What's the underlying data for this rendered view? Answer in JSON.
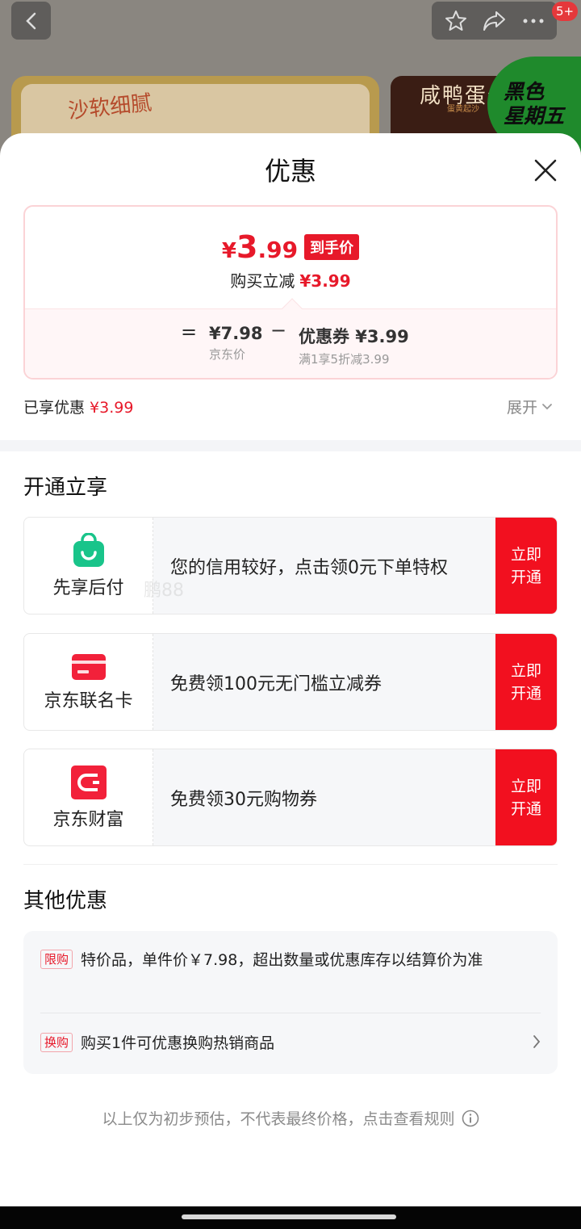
{
  "background": {
    "card1_text": "沙软细腻",
    "card2_title": "咸鸭蛋仁",
    "card2_sub": "蛋黄起沙",
    "promo_badge_line1": "黑色",
    "promo_badge_line2": "星期五",
    "notification_badge": "5+"
  },
  "sheet": {
    "title": "优惠",
    "price": {
      "currency": "¥",
      "integer": "3",
      "decimal": ".99",
      "tag": "到手价",
      "reduce_label": "购买立减",
      "reduce_value": "¥3.99",
      "base_value": "¥7.98",
      "base_label": "京东价",
      "coupon_value": "优惠券 ¥3.99",
      "coupon_label": "满1享5折减3.99",
      "eq": "=",
      "minus": "−"
    },
    "enjoyed_label": "已享优惠",
    "enjoyed_value": "¥3.99",
    "expand_label": "展开"
  },
  "activate": {
    "title": "开通立享",
    "items": [
      {
        "label": "先享后付",
        "desc": "您的信用较好，点击领0元下单特权",
        "btn_line1": "立即",
        "btn_line2": "开通",
        "icon": "shopping-bag-icon"
      },
      {
        "label": "京东联名卡",
        "desc": "免费领100元无门槛立减券",
        "btn_line1": "立即",
        "btn_line2": "开通",
        "icon": "credit-card-icon"
      },
      {
        "label": "京东财富",
        "desc": "免费领30元购物券",
        "btn_line1": "立即",
        "btn_line2": "开通",
        "icon": "wallet-icon"
      }
    ],
    "watermark": "鹏88"
  },
  "other": {
    "title": "其他优惠",
    "rows": [
      {
        "tag": "限购",
        "text": "特价品，单件价￥7.98，超出数量或优惠库存以结算价为准"
      },
      {
        "tag": "换购",
        "text": "购买1件可优惠换购热销商品"
      }
    ]
  },
  "note": "以上仅为初步预估，不代表最终价格，点击查看规则",
  "colors": {
    "accent_red": "#e7192a",
    "button_red": "#f2101f",
    "green": "#19c48a"
  }
}
